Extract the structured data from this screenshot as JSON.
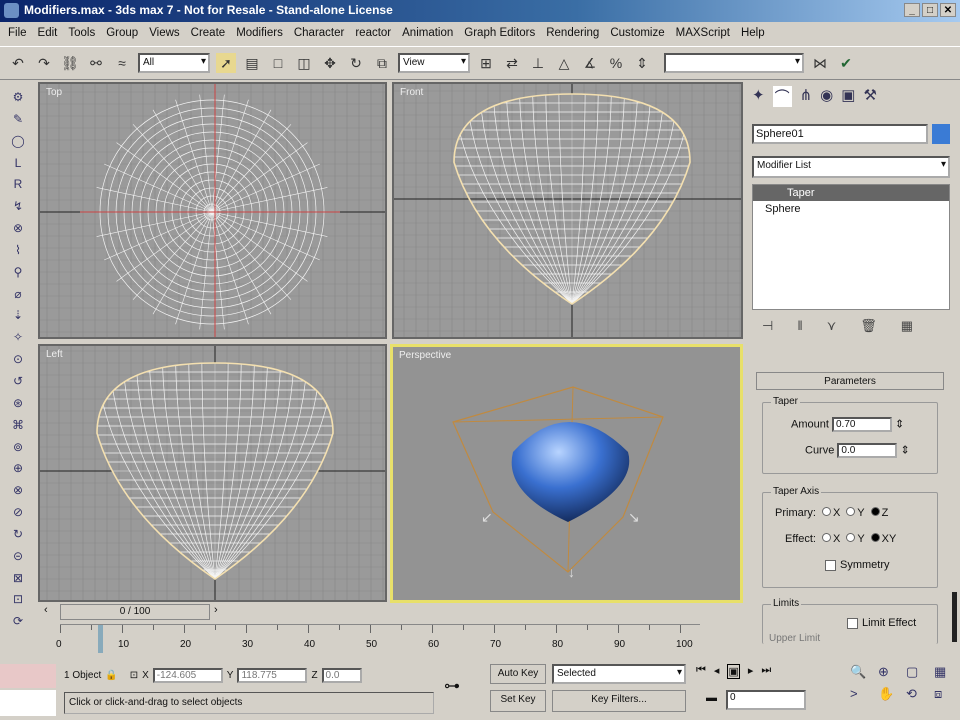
{
  "window": {
    "title": "Modifiers.max - 3ds max 7 - Not for Resale - Stand-alone License",
    "controls": [
      "_",
      "□",
      "✕"
    ]
  },
  "menu": [
    "File",
    "Edit",
    "Tools",
    "Group",
    "Views",
    "Create",
    "Modifiers",
    "Character",
    "reactor",
    "Animation",
    "Graph Editors",
    "Rendering",
    "Customize",
    "MAXScript",
    "Help"
  ],
  "toolbar": {
    "selection_filter": "All",
    "reference_coord": "View",
    "named_selection": ""
  },
  "viewports": [
    {
      "label": "Top"
    },
    {
      "label": "Front"
    },
    {
      "label": "Left"
    },
    {
      "label": "Perspective"
    }
  ],
  "command_panel": {
    "object_name": "Sphere01",
    "object_color": "#3a7bd5",
    "modifier_list": "Modifier List",
    "stack": [
      "Taper",
      "Sphere"
    ],
    "rollout": "Parameters",
    "taper": {
      "title": "Taper",
      "amount_label": "Amount",
      "amount": "0.70",
      "curve_label": "Curve",
      "curve": "0.0"
    },
    "taper_axis": {
      "title": "Taper Axis",
      "primary_label": "Primary:",
      "effect_label": "Effect:",
      "primary": [
        "X",
        "Y",
        "Z"
      ],
      "effect": [
        "X",
        "Y",
        "XY"
      ],
      "primary_selected": 2,
      "effect_selected": 2,
      "symmetry": "Symmetry"
    },
    "limits": {
      "title": "Limits",
      "limit_effect": "Limit Effect",
      "upper_limit": "Upper Limit"
    }
  },
  "timeline": {
    "frame": "0 / 100",
    "ticks": [
      "0",
      "10",
      "20",
      "30",
      "40",
      "50",
      "60",
      "70",
      "80",
      "90",
      "100"
    ]
  },
  "status": {
    "selection": "1 Object",
    "x_label": "X",
    "x": "-124.605",
    "y_label": "Y",
    "y": "118.775",
    "z_label": "Z",
    "z": "0.0",
    "prompt": "Click or click-and-drag to select objects",
    "auto_key": "Auto Key",
    "set_key": "Set Key",
    "key_mode": "Selected",
    "key_filters": "Key Filters...",
    "current_frame": "0"
  }
}
